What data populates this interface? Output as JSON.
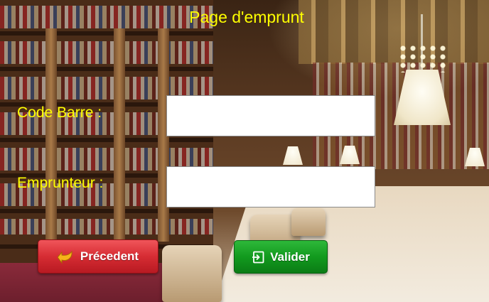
{
  "window": {
    "title": "Page d'emprunt"
  },
  "form": {
    "barcode": {
      "label": "Code Barre :",
      "value": "",
      "placeholder": ""
    },
    "borrower": {
      "label": "Emprunteur :",
      "value": "",
      "placeholder": ""
    }
  },
  "actions": {
    "previous": {
      "label": "Précedent",
      "icon": "back-arrow-icon",
      "color": "#d62c33"
    },
    "validate": {
      "label": "Valider",
      "icon": "sign-in-icon",
      "color": "#129a1e"
    }
  },
  "theme": {
    "label_color": "#ffff00",
    "background": "library-reading-room-photo"
  }
}
